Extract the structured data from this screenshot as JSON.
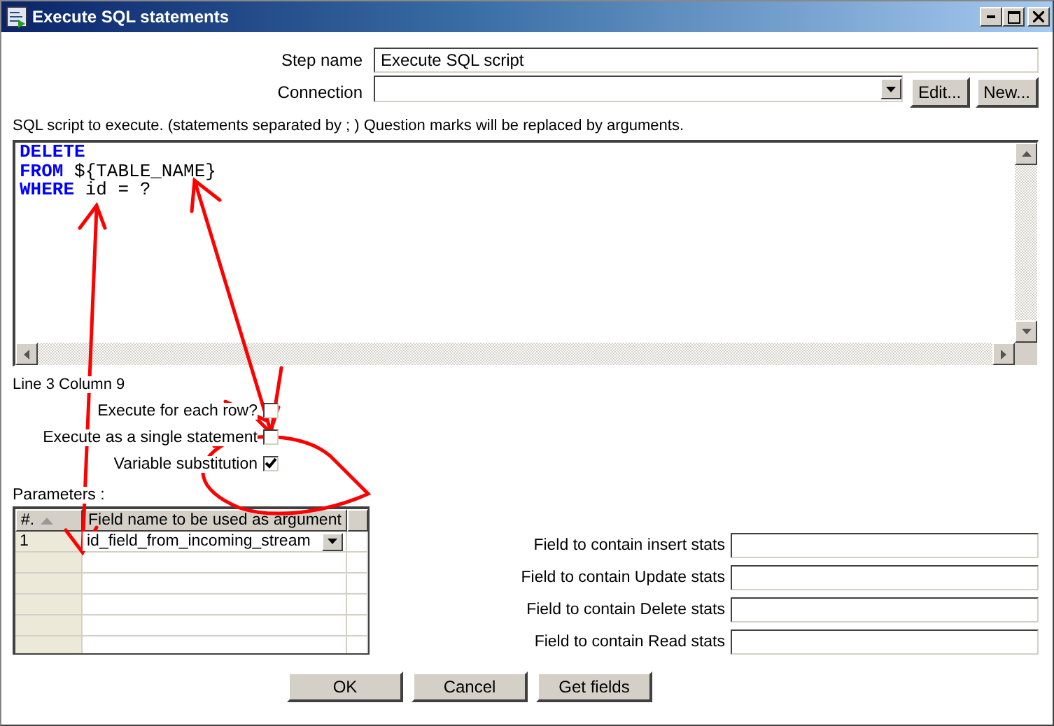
{
  "window": {
    "title": "Execute SQL statements"
  },
  "step_name": {
    "label": "Step name",
    "value": "Execute SQL script"
  },
  "connection": {
    "label": "Connection",
    "buttons": [
      "Edit...",
      "New..."
    ]
  },
  "sql_hint": "SQL script to execute. (statements separated by ; ) Question marks will be replaced by arguments.",
  "sql_editor": {
    "lines": [
      [
        {
          "kind": "keyword",
          "text": "DELETE"
        }
      ],
      [
        {
          "kind": "keyword",
          "text": "FROM"
        },
        {
          "kind": "plain",
          "text": " ${TABLE_NAME}"
        }
      ],
      [
        {
          "kind": "keyword",
          "text": "WHERE"
        },
        {
          "kind": "plain",
          "text": " id = ?"
        }
      ]
    ]
  },
  "cursor_position": "Line 3 Column 9",
  "options": [
    {
      "label": "Execute for each row?",
      "checked": false
    },
    {
      "label": "Execute as a single statement",
      "checked": false
    },
    {
      "label": "Variable substitution",
      "checked": true
    }
  ],
  "parameters": {
    "label": "Parameters :",
    "columns": [
      "#.",
      "Field name to be used as argument"
    ],
    "rows": [
      {
        "number": "1",
        "field": "id_field_from_incoming_stream"
      }
    ]
  },
  "stats_fields": [
    {
      "label": "Field to contain insert stats"
    },
    {
      "label": "Field to contain Update stats"
    },
    {
      "label": "Field to contain Delete stats"
    },
    {
      "label": "Field to contain Read stats"
    }
  ],
  "buttons": [
    "OK",
    "Cancel",
    "Get fields"
  ]
}
